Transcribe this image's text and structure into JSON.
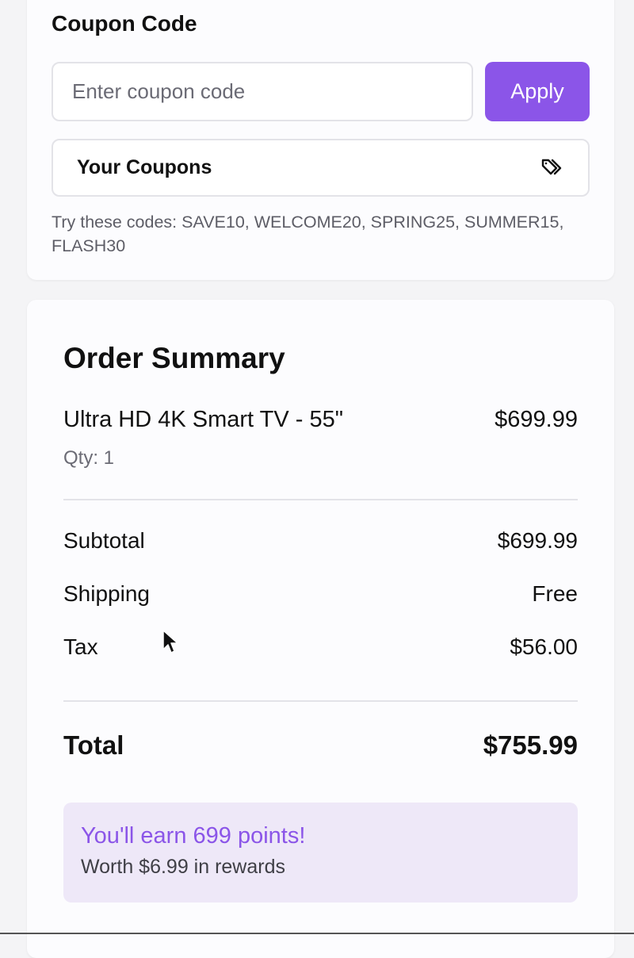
{
  "coupon": {
    "title": "Coupon Code",
    "input_placeholder": "Enter coupon code",
    "input_value": "",
    "apply_label": "Apply",
    "your_coupons_label": "Your Coupons",
    "hint": "Try these codes: SAVE10, WELCOME20, SPRING25, SUMMER15, FLASH30"
  },
  "summary": {
    "title": "Order Summary",
    "item": {
      "name": "Ultra HD 4K Smart TV - 55\"",
      "price": "$699.99",
      "qty": "Qty: 1"
    },
    "subtotal": {
      "label": "Subtotal",
      "value": "$699.99"
    },
    "shipping": {
      "label": "Shipping",
      "value": "Free"
    },
    "tax": {
      "label": "Tax",
      "value": "$56.00"
    },
    "total": {
      "label": "Total",
      "value": "$755.99"
    },
    "rewards": {
      "points": "You'll earn 699 points!",
      "worth": "Worth $6.99 in rewards"
    }
  },
  "colors": {
    "accent": "#8b55e8",
    "rewards_bg": "#eee8f8",
    "border": "#e3e3e8"
  },
  "icons": {
    "your_coupons": "tags-icon"
  }
}
